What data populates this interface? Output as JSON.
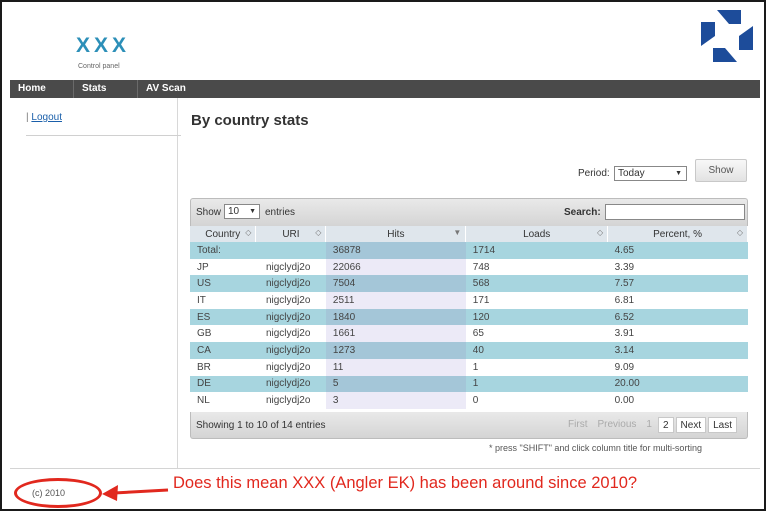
{
  "header": {
    "logo": "XXX",
    "subtitle": "Control panel"
  },
  "nav": {
    "items": [
      "Home",
      "Stats",
      "AV Scan"
    ]
  },
  "sidebar": {
    "logout_prefix": "|",
    "logout": "Logout"
  },
  "main": {
    "title": "By country stats",
    "period_label": "Period:",
    "period_value": "Today",
    "show_button": "Show"
  },
  "table": {
    "length_prefix": "Show",
    "length_value": "10",
    "length_suffix": "entries",
    "search_label": "Search:",
    "columns": [
      "Country",
      "URI",
      "Hits",
      "Loads",
      "Percent, %"
    ],
    "rows": [
      [
        "Total:",
        "",
        "36878",
        "1714",
        "4.65"
      ],
      [
        "JP",
        "nigclydj2o",
        "22066",
        "748",
        "3.39"
      ],
      [
        "US",
        "nigclydj2o",
        "7504",
        "568",
        "7.57"
      ],
      [
        "IT",
        "nigclydj2o",
        "2511",
        "171",
        "6.81"
      ],
      [
        "ES",
        "nigclydj2o",
        "1840",
        "120",
        "6.52"
      ],
      [
        "GB",
        "nigclydj2o",
        "1661",
        "65",
        "3.91"
      ],
      [
        "CA",
        "nigclydj2o",
        "1273",
        "40",
        "3.14"
      ],
      [
        "BR",
        "nigclydj2o",
        "11",
        "1",
        "9.09"
      ],
      [
        "DE",
        "nigclydj2o",
        "5",
        "1",
        "20.00"
      ],
      [
        "NL",
        "nigclydj2o",
        "3",
        "0",
        "0.00"
      ]
    ],
    "info": "Showing 1 to 10 of 14 entries",
    "pager": {
      "first": "First",
      "previous": "Previous",
      "pages": [
        "1",
        "2"
      ],
      "next": "Next",
      "last": "Last"
    },
    "hint": "* press \"SHIFT\" and click column title for multi-sorting"
  },
  "footer": {
    "copyright": "(c) 2010",
    "annotation": "Does this mean XXX (Angler EK) has been around since 2010?"
  },
  "colors": {
    "logo": "#2c8fb8",
    "brand": "#1d4c9a",
    "nav": "#4a4a4a",
    "annotation": "#e1281e",
    "row_highlight": "#a7d5df"
  }
}
